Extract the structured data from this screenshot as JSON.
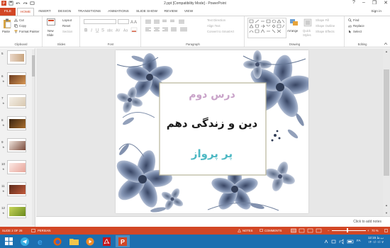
{
  "window": {
    "title": "2.ppt [Compatibility Mode] - PowerPoint",
    "help": "?",
    "minimize": "–",
    "restore": "❐",
    "close": "✕",
    "sign_in": "Sign in"
  },
  "tabs": [
    {
      "label": "FILE"
    },
    {
      "label": "HOME"
    },
    {
      "label": "INSERT"
    },
    {
      "label": "DESIGN"
    },
    {
      "label": "TRANSITIONS"
    },
    {
      "label": "ANIMATIONS"
    },
    {
      "label": "SLIDE SHOW"
    },
    {
      "label": "REVIEW"
    },
    {
      "label": "VIEW"
    }
  ],
  "ribbon": {
    "clipboard": {
      "label": "Clipboard",
      "paste": "Paste",
      "cut": "Cut",
      "copy": "Copy",
      "format_painter": "Format Painter"
    },
    "slides": {
      "label": "Slides",
      "new_slide": "New",
      "new_slide2": "Slide",
      "layout": "Layout",
      "reset": "Reset",
      "section": "Section"
    },
    "font": {
      "label": "Font"
    },
    "paragraph": {
      "label": "Paragraph",
      "text_direction": "Text Direction",
      "align_text": "Align Text",
      "convert": "Convert to SmartArt"
    },
    "drawing": {
      "label": "Drawing",
      "arrange": "Arrange",
      "quick_styles": "Quick",
      "quick_styles2": "Styles",
      "shape_fill": "Shape Fill",
      "shape_outline": "Shape Outline",
      "shape_effects": "Shape Effects"
    },
    "editing": {
      "label": "Editing",
      "find": "Find",
      "replace": "Replace",
      "select": "Select"
    }
  },
  "thumbnails": [
    {
      "number": "5",
      "star": ""
    },
    {
      "number": "6",
      "star": "★"
    },
    {
      "number": "7",
      "star": "★"
    },
    {
      "number": "8",
      "star": "★"
    },
    {
      "number": "9",
      "star": "★"
    },
    {
      "number": "10",
      "star": "★"
    },
    {
      "number": "11",
      "star": "★"
    },
    {
      "number": "12",
      "star": "★"
    }
  ],
  "slide": {
    "line1": "درس دوم",
    "line2": "دین و زندگی دهم",
    "line3": "پر پرواز",
    "colors": {
      "line1": "#c9a3c9",
      "line2": "#1a1a1a",
      "line3": "#4fb9c4",
      "frame": "#b8b49a",
      "flower": "#6f7f9d"
    }
  },
  "notes_placeholder": "Click to add notes",
  "status": {
    "slide_of": "SLIDE 2 OF 28",
    "language": "PERSIAN",
    "notes": "NOTES",
    "comments": "COMMENTS",
    "zoom": "70 %",
    "accent": "#d24726"
  },
  "taskbar": {
    "clock_time": "12:15 ب.ظ",
    "clock_date": "۱۴۰۱/۰۱/۰۷",
    "lang": "FA"
  }
}
